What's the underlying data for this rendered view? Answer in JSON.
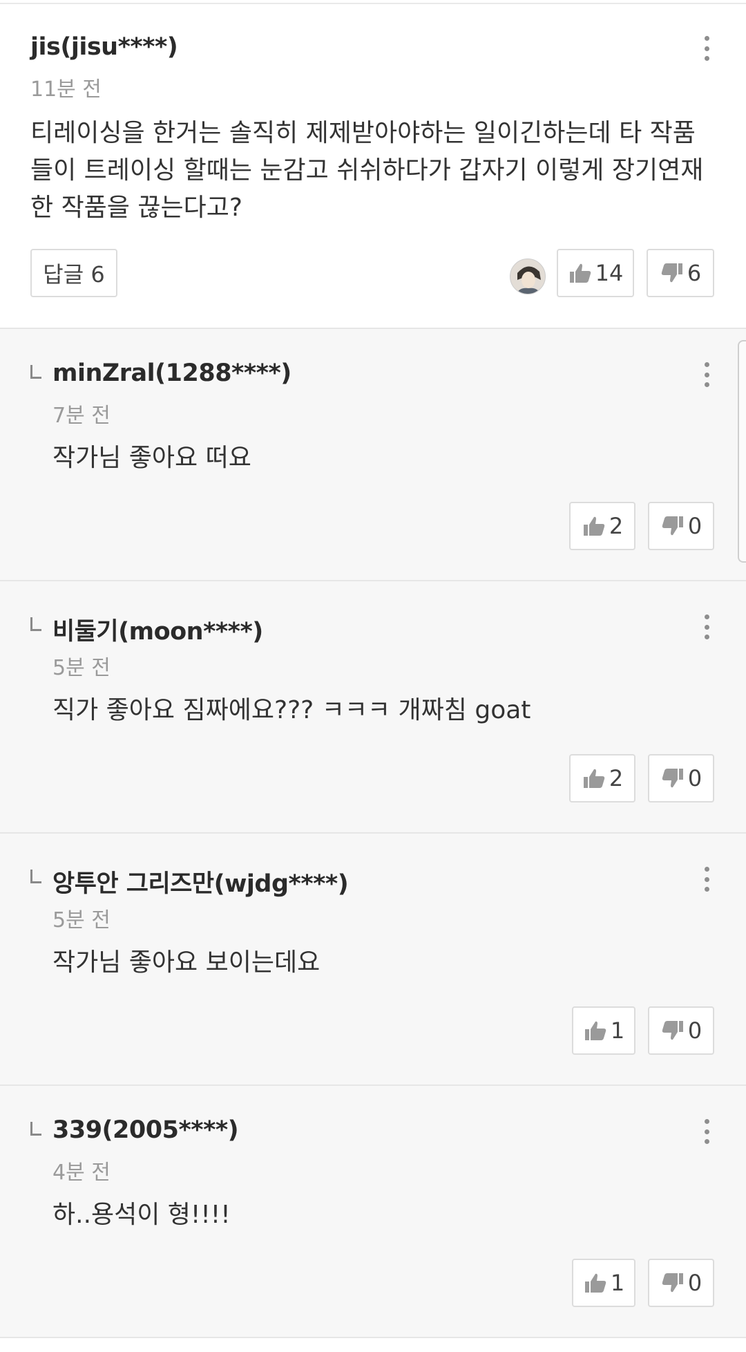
{
  "main_comment": {
    "author": "jis(jisu****)",
    "time": "11분 전",
    "text_line1": "티레이싱을 한거는 솔직히 제제받아야하는 일이긴하는데 타 작품",
    "text_line2": "들이 트레이싱 할때는 눈감고 쉬쉬하다가 갑자기 이렇게 장기연재",
    "text_line3": "한 작품을 끊는다고?",
    "reply_button": "답글 6",
    "likes": "14",
    "dislikes": "6"
  },
  "replies": [
    {
      "author": "minZral(1288****)",
      "time": "7분 전",
      "text": "작가님 좋아요 떠요",
      "likes": "2",
      "dislikes": "0"
    },
    {
      "author": "비둘기(moon****)",
      "time": "5분 전",
      "text": "직가 좋아요 짐짜에요??? ㅋㅋㅋ 개짜침 goat",
      "likes": "2",
      "dislikes": "0"
    },
    {
      "author": "앙투안 그리즈만(wjdg****)",
      "time": "5분 전",
      "text": "작가님 좋아요 보이는데요",
      "likes": "1",
      "dislikes": "0"
    },
    {
      "author": "339(2005****)",
      "time": "4분 전",
      "text": "하..용석이 형!!!!",
      "likes": "1",
      "dislikes": "0"
    }
  ],
  "icons": {
    "like": "thumbs-up-icon",
    "dislike": "thumbs-down-icon",
    "more": "more-vertical-icon"
  },
  "colors": {
    "reply_bg": "#f7f7f7",
    "border": "#dcdcdc",
    "muted_text": "#9a9a9a"
  }
}
